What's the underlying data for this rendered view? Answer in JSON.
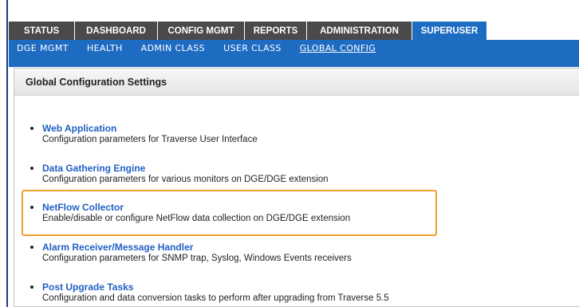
{
  "top_tabs": [
    "STATUS",
    "DASHBOARD",
    "CONFIG MGMT",
    "REPORTS",
    "ADMINISTRATION",
    "SUPERUSER"
  ],
  "active_top_tab": "SUPERUSER",
  "sub_nav": [
    "DGE MGMT",
    "HEALTH",
    "ADMIN CLASS",
    "USER CLASS",
    "GLOBAL CONFIG"
  ],
  "active_sub_nav": "GLOBAL CONFIG",
  "panel": {
    "title": "Global Configuration Settings"
  },
  "entries": [
    {
      "title": "Web Application",
      "desc": "Configuration parameters for Traverse User Interface"
    },
    {
      "title": "Data Gathering Engine",
      "desc": "Configuration parameters for various monitors on DGE/DGE extension"
    },
    {
      "title": "NetFlow Collector",
      "desc": "Enable/disable or configure NetFlow data collection on DGE/DGE extension"
    },
    {
      "title": "Alarm Receiver/Message Handler",
      "desc": "Configuration parameters for SNMP trap, Syslog, Windows Events receivers"
    },
    {
      "title": "Post Upgrade Tasks",
      "desc": "Configuration and data conversion tasks to perform after upgrading from Traverse 5.5"
    }
  ],
  "highlighted_entry": "NetFlow Collector",
  "colors": {
    "highlight": "#f0a030",
    "active_tab": "#1e6bc2",
    "tab_bg": "#4a4a4a",
    "link": "#2160c4"
  }
}
